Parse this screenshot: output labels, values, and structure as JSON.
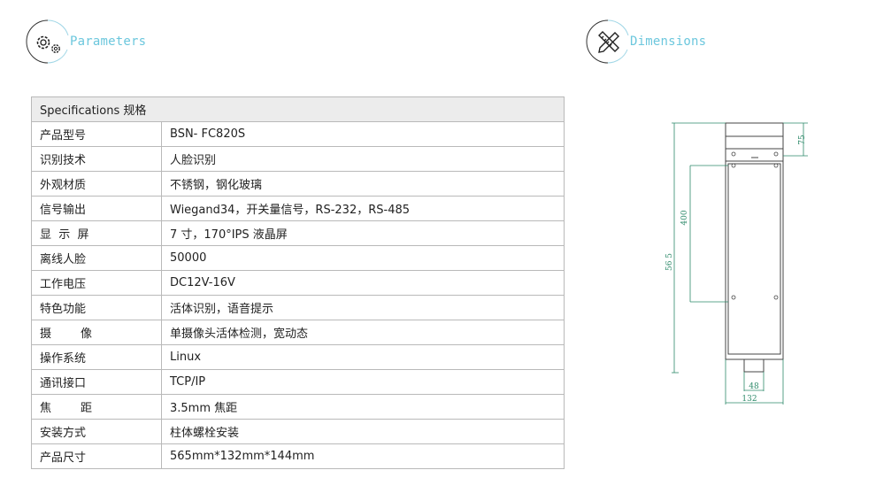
{
  "parameters": {
    "title": "Parameters"
  },
  "dimensions": {
    "title": "Dimensions",
    "labels": {
      "d75": "75",
      "d400": "400",
      "d565": "56 5",
      "d48": "48",
      "d132": "132"
    },
    "line_color": "#2e8a6a"
  },
  "table": {
    "header": "Specifications  规格",
    "rows": [
      {
        "key": "产品型号",
        "value": "BSN- FC820S"
      },
      {
        "key": "识别技术",
        "value": "人脸识别"
      },
      {
        "key": "外观材质",
        "value": "不锈钢，钢化玻璃"
      },
      {
        "key": "信号输出",
        "value": "Wiegand34，开关量信号，RS-232，RS-485"
      },
      {
        "key": "显  示  屏",
        "value": "7 寸，170°IPS 液晶屏"
      },
      {
        "key": "离线人脸",
        "value": "50000"
      },
      {
        "key": "工作电压",
        "value": "DC12V-16V"
      },
      {
        "key": "特色功能",
        "value": "活体识别，语音提示"
      },
      {
        "key": "摄        像",
        "value": "单摄像头活体检测，宽动态"
      },
      {
        "key": "操作系统",
        "value": "Linux"
      },
      {
        "key": "通讯接口",
        "value": "TCP/IP"
      },
      {
        "key": "焦        距",
        "value": "3.5mm 焦距"
      },
      {
        "key": "安装方式",
        "value": "柱体螺栓安装"
      },
      {
        "key": "产品尺寸",
        "value": "565mm*132mm*144mm"
      }
    ]
  },
  "icons": {
    "params": "gears-icon",
    "dims": "ruler-pencil-icon",
    "accent": "#6cc7dd"
  }
}
